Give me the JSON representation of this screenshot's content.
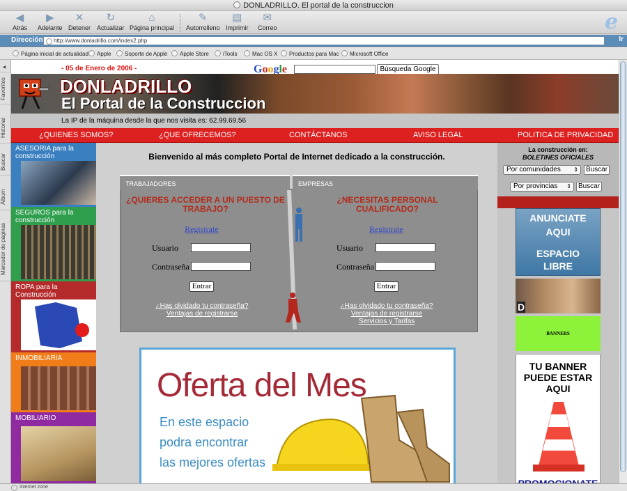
{
  "window": {
    "title": "DONLADRILLO. El portal de la construccion"
  },
  "toolbar": {
    "back": "Atrás",
    "forward": "Adelante",
    "stop": "Detener",
    "refresh": "Actualizar",
    "home": "Página principal",
    "autofill": "Autorrelleno",
    "print": "Imprimir",
    "mail": "Correo"
  },
  "address": {
    "label": "Dirección:",
    "url": "http://www.donladrillo.com/index2.php",
    "go": "Ir"
  },
  "favorites": [
    "Página inicial de actualidad",
    "Apple",
    "Soporte de Apple",
    "Apple Store",
    "iTools",
    "Mac OS X",
    "Productos para Mac",
    "Microsoft Office"
  ],
  "side_tabs": [
    "Favoritos",
    "Historial",
    "Buscar",
    "Álbum",
    "Marcador de páginas"
  ],
  "status": "Internet zone",
  "site": {
    "date": "- 05 de Enero de 2006 -",
    "google": {
      "logo": "Google",
      "button": "Búsqueda Google"
    },
    "brand": {
      "name": "DONLADRILLO",
      "tagline": "El Portal de la Construccion"
    },
    "ip_text": "La IP de la máquina desde la que nos visita es: 62.99.69.56",
    "menu": [
      "¿QUIENES SOMOS?",
      "¿QUE OFRECEMOS?",
      "CONTÁCTANOS",
      "AVISO LEGAL",
      "POLITICA DE PRIVACIDAD"
    ],
    "categories": [
      {
        "label": "ASESORIA para la construcción",
        "color": "#3a7fc0"
      },
      {
        "label": "SEGUROS para la construcción",
        "color": "#2f9f4d"
      },
      {
        "label": "ROPA para la Construcción",
        "color": "#b52a2a"
      },
      {
        "label": "INMOBILIARIA",
        "color": "#f07d1a"
      },
      {
        "label": "MOBILIARIO",
        "color": "#8f2aa0"
      }
    ],
    "welcome": "Bienvenido al más completo Portal de Internet dedicado a la construcción.",
    "workers": {
      "tab": "TRABAJADORES",
      "title": "¿QUIERES ACCEDER A UN PUESTO DE TRABAJO?",
      "register": "Registrate",
      "user": "Usuario",
      "password": "Contraseña",
      "enter": "Entrar",
      "forgot": "¿Has olvidado tu contraseña?",
      "advantages": "Ventajas de registrarse"
    },
    "companies": {
      "tab": "EMPRESAS",
      "title": "¿NECESITAS PERSONAL CUALIFICADO?",
      "register": "Registrate",
      "user": "Usuario",
      "password": "Contraseña",
      "enter": "Entrar",
      "forgot": "¿Has olvidado tu contraseña?",
      "advantages": "Ventajas de registrarse",
      "services": "Servicios y Tarifas"
    },
    "offer": {
      "title": "Oferta del Mes",
      "line1": "En este espacio",
      "line2": "podra encontrar",
      "line3": "las mejores ofertas"
    },
    "boletines": {
      "title1": "La construcción en:",
      "title2": "BOLETINES OFICIALES",
      "select1": "Por comunidades",
      "select2": "Por provincias",
      "search": "Buscar"
    },
    "ads": {
      "anun1": "ANUNCIATE",
      "anun2": "AQUI",
      "anun3": "ESPACIO",
      "anun4": "LIBRE",
      "banners": "BANNERS",
      "promo1": "TU BANNER",
      "promo2": "PUEDE ESTAR",
      "promo3": "AQUI",
      "promo4": "PROMOCIONATE"
    }
  }
}
